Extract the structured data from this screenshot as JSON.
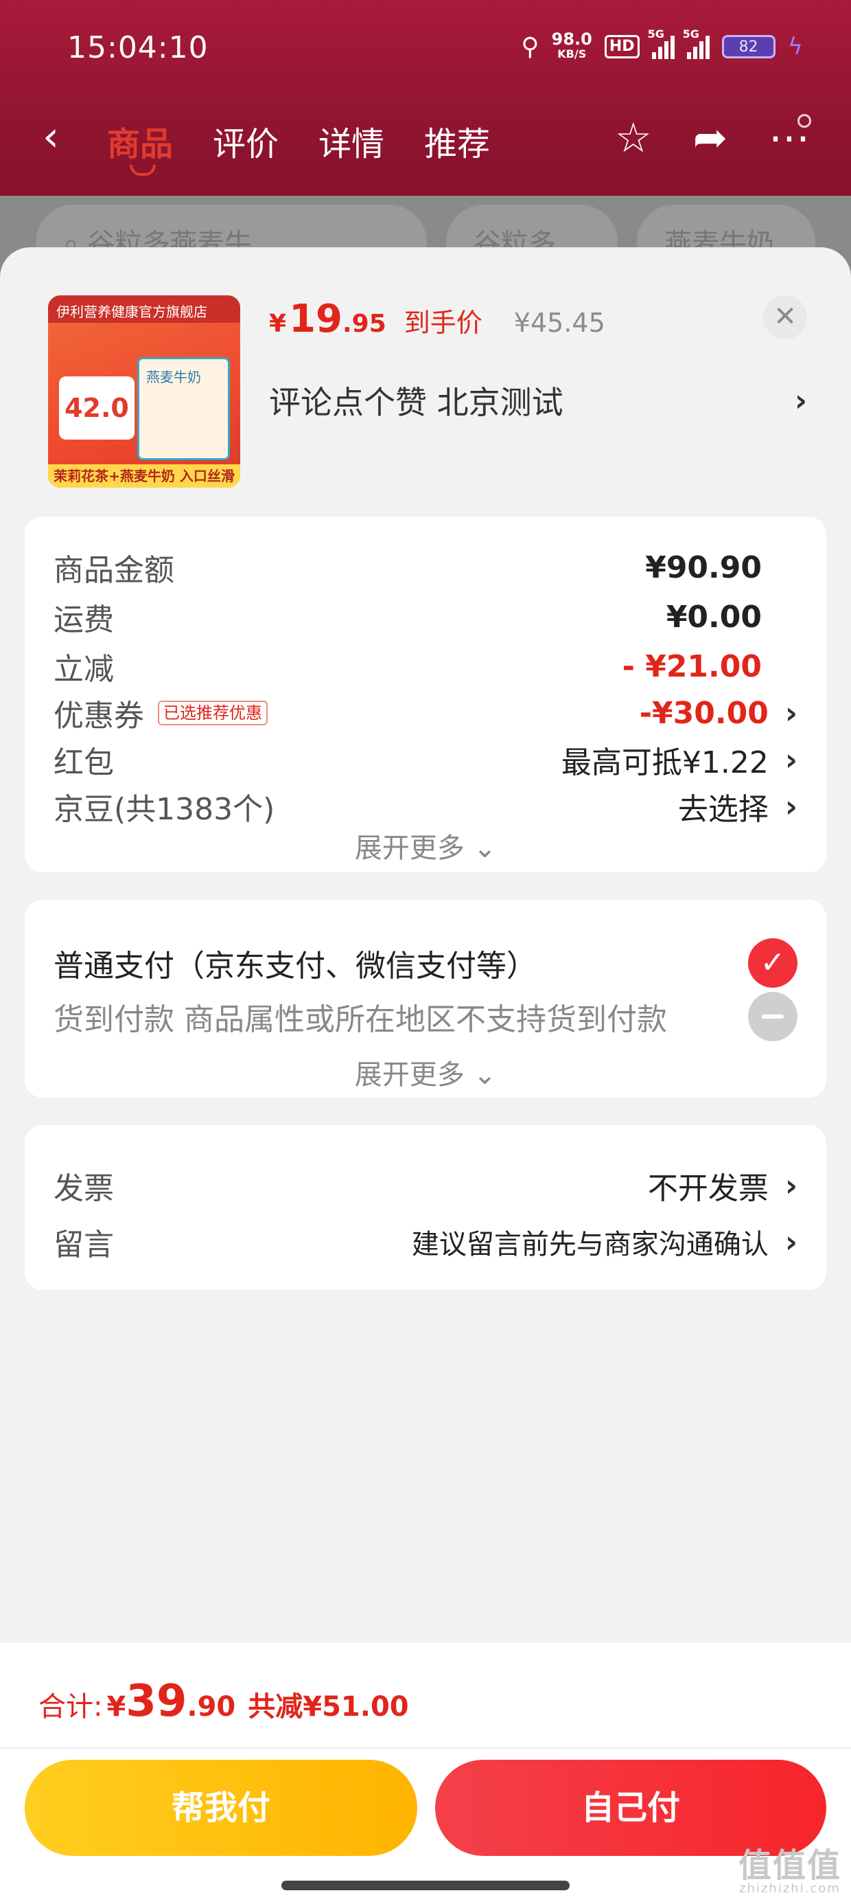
{
  "status_bar": {
    "time": "15:04:10",
    "net_speed": "98.0",
    "net_unit": "KB/S",
    "hd": "HD",
    "sig1": "5G",
    "sig2": "5G",
    "battery": "82"
  },
  "nav": {
    "back_icon": "‹",
    "tabs": [
      {
        "label": "商品",
        "active": true
      },
      {
        "label": "评价"
      },
      {
        "label": "详情"
      },
      {
        "label": "推荐"
      }
    ],
    "star_icon": "☆",
    "share_icon": "➦",
    "more_icon": "⋯"
  },
  "backdrop_search": {
    "search_text": "谷粒多燕麦牛",
    "pill_1": "谷粒多",
    "pill_2": "燕麦牛奶"
  },
  "product": {
    "thumb_store": "伊利营养健康官方旗舰店",
    "thumb_price": "42.0",
    "thumb_box": "燕麦牛奶",
    "thumb_slogan": "茉莉花茶+燕麦牛奶 入口丝滑",
    "currency": "¥",
    "price_int": "19",
    "price_dec": ".95",
    "price_label": "到手价",
    "orig_price": "¥45.45",
    "address": "评论点个赞  北京测试",
    "close_icon": "✕"
  },
  "summary": {
    "rows": [
      {
        "label": "商品金额",
        "value": "¥90.90"
      },
      {
        "label": "运费",
        "value": "¥0.00"
      },
      {
        "label": "立减",
        "value": "- ¥21.00"
      },
      {
        "label": "优惠券",
        "tag": "已选推荐优惠",
        "value": "-¥30.00"
      },
      {
        "label": "红包",
        "value": "最高可抵¥1.22"
      },
      {
        "label": "京豆(共1383个)",
        "value": "去选择"
      }
    ],
    "expand": "展开更多 ⌄"
  },
  "payment": {
    "normal": "普通支付（京东支付、微信支付等）",
    "cod": "货到付款 商品属性或所在地区不支持货到付款",
    "check_icon": "✓",
    "expand": "展开更多 ⌄"
  },
  "extras": {
    "invoice_label": "发票",
    "invoice_value": "不开发票",
    "note_label": "留言",
    "note_placeholder": "建议留言前先与商家沟通确认"
  },
  "footer": {
    "total_label": "合计:",
    "currency": "¥",
    "total_int": "39",
    "total_dec": ".90",
    "total_save": "共减¥51.00",
    "btn_help": "帮我付",
    "btn_self": "自己付",
    "watermark": "值值值",
    "watermark_url": "zhizhizhi.com"
  },
  "chevron": "›",
  "colors": {
    "accent_red": "#e1251b",
    "button_red": "#f4404a",
    "button_yellow": "#ffc107"
  }
}
